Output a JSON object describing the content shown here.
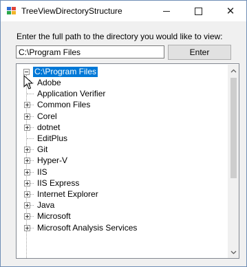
{
  "window": {
    "title": "TreeViewDirectoryStructure",
    "icon": "forms-app-icon",
    "controls": {
      "minimize": "minimize-icon",
      "maximize": "maximize-icon",
      "close": "close-icon",
      "close_glyph": "✕"
    }
  },
  "form": {
    "prompt": "Enter the full path to the directory you would like to view:",
    "path_value": "C:\\Program Files",
    "enter_label": "Enter"
  },
  "tree": {
    "root": "C:\\Program Files",
    "items": [
      {
        "label": "Adobe",
        "expandable": true
      },
      {
        "label": "Application Verifier",
        "expandable": false
      },
      {
        "label": "Common Files",
        "expandable": true
      },
      {
        "label": "Corel",
        "expandable": true
      },
      {
        "label": "dotnet",
        "expandable": true
      },
      {
        "label": "EditPlus",
        "expandable": false
      },
      {
        "label": "Git",
        "expandable": true
      },
      {
        "label": "Hyper-V",
        "expandable": true
      },
      {
        "label": "IIS",
        "expandable": true
      },
      {
        "label": "IIS Express",
        "expandable": true
      },
      {
        "label": "Internet Explorer",
        "expandable": true
      },
      {
        "label": "Java",
        "expandable": true
      },
      {
        "label": "Microsoft",
        "expandable": true
      },
      {
        "label": "Microsoft Analysis Services",
        "expandable": true
      }
    ]
  },
  "scrollbar": {
    "up": "chevron-up-icon",
    "down": "chevron-down-icon"
  },
  "colors": {
    "selection": "#0078d7",
    "window_bg": "#f0f0f0"
  }
}
